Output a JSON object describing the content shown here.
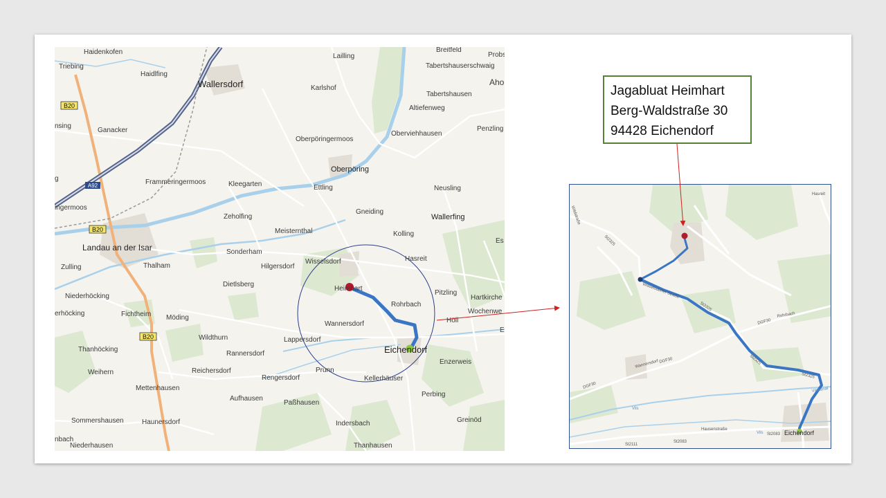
{
  "address": {
    "name": "Jagabluat Heimhart",
    "street": "Berg-Waldstraße 30",
    "city": "94428 Eichendorf"
  },
  "colors": {
    "route": "#3a76c4",
    "destination_marker": "#b01c2e",
    "origin_marker": "#8dc63f",
    "box_border": "#548235",
    "pointer": "#d02020",
    "circle": "#2c3e8c"
  },
  "main_map": {
    "places": {
      "haidenkofen": "Haidenkofen",
      "lailling": "Lailling",
      "breitfeld": "Breitfeld",
      "probs": "Probs",
      "triebing": "Triebing",
      "wallersdorf": "Wallersdorf",
      "haidlfing": "Haidlfing",
      "tabertshausenschwaig": "Tabertshauserschwaig",
      "karlshof": "Karlshof",
      "tabertshausen": "Tabertshausen",
      "aho": "Aho",
      "altiefenweg": "Altiefenweg",
      "ganacker": "Ganacker",
      "nsing": "nsing",
      "penzling": "Penzling",
      "oberporingermoos": "Oberpöringermoos",
      "oberviehhausen": "Oberviehhausen",
      "oberporing": "Oberpöring",
      "frammeringermoos": "Frammeringermoos",
      "kleegarten": "Kleegarten",
      "ettling": "Ettling",
      "neusling": "Neusling",
      "g": "g",
      "ingermoos": "ingermoos",
      "zeholfing": "Zeholfing",
      "gneiding": "Gneiding",
      "wallerfing": "Wallerfing",
      "meisternthal": "Meisternthal",
      "kolling": "Kolling",
      "landau": "Landau an der Isar",
      "es": "Es",
      "sonderham": "Sonderham",
      "hasreit": "Hasreit",
      "wisselsdorf": "Wisselsdorf",
      "zulling": "Zulling",
      "thalham": "Thalham",
      "hilgersdorf": "Hilgersdorf",
      "dietlsberg": "Dietlsberg",
      "heimhart": "Heimhart",
      "pitzling": "Pitzling",
      "hartkirche": "Hartkirche",
      "niederhocking": "Niederhöcking",
      "rohrbach": "Rohrbach",
      "wochenwe": "Wochenwe",
      "erhocking": "erhöcking",
      "fichtheim": "Fichtheim",
      "moding": "Möding",
      "wannersdorf": "Wannersdorf",
      "holl": "Höll",
      "e": "E",
      "thanhocking": "Thanhöcking",
      "wildthurn": "Wildthurn",
      "lappersdorf": "Lappersdorf",
      "eichendorf": "Eichendorf",
      "weihern": "Weihern",
      "rannersdorf": "Rannersdorf",
      "enzerweis": "Enzerweis",
      "reichersdorf": "Reichersdorf",
      "prunn": "Prunn",
      "rengersdorf": "Rengersdorf",
      "kellerhauser": "Kellerhäuser",
      "mettenhausen": "Mettenhausen",
      "perbing": "Perbing",
      "aufhausen": "Aufhausen",
      "passhausen": "Paßhausen",
      "sommershausen": "Sommershausen",
      "haunersdorf": "Haunersdorf",
      "greinod": "Greinöd",
      "indersbach": "Indersbach",
      "nbach": "nbach",
      "niederhausen": "Niederhausen",
      "thanhausen": "Thanhausen"
    },
    "shields": {
      "b20_top": "B20",
      "a92": "A92",
      "b20_mid": "B20",
      "b20_bottom": "B20"
    }
  },
  "detail_map": {
    "labels": {
      "hasreit": "Hasreit",
      "eichendorf": "Eichendorf",
      "wisselsdorfer_str": "Wisselsdorfer Straße",
      "st2325_a": "St2325",
      "st2325_b": "St2325",
      "st2325_c": "St2325",
      "st2325_d": "St2325",
      "dgf30_a": "DGF30",
      "dgf30_b": "DGF30",
      "dgf30_c": "DGF30",
      "rohrbach": "Rohrbach",
      "wannersdorf": "Wannersdorf",
      "vilskanal": "Vilskanal",
      "vils_a": "Vils",
      "vils_b": "Vils",
      "hausenstrasse": "Hausenstraße",
      "st2083_a": "St2083",
      "st2083_b": "St2083",
      "st2111": "St2111",
      "wildstrasse": "Wildstraße"
    }
  }
}
